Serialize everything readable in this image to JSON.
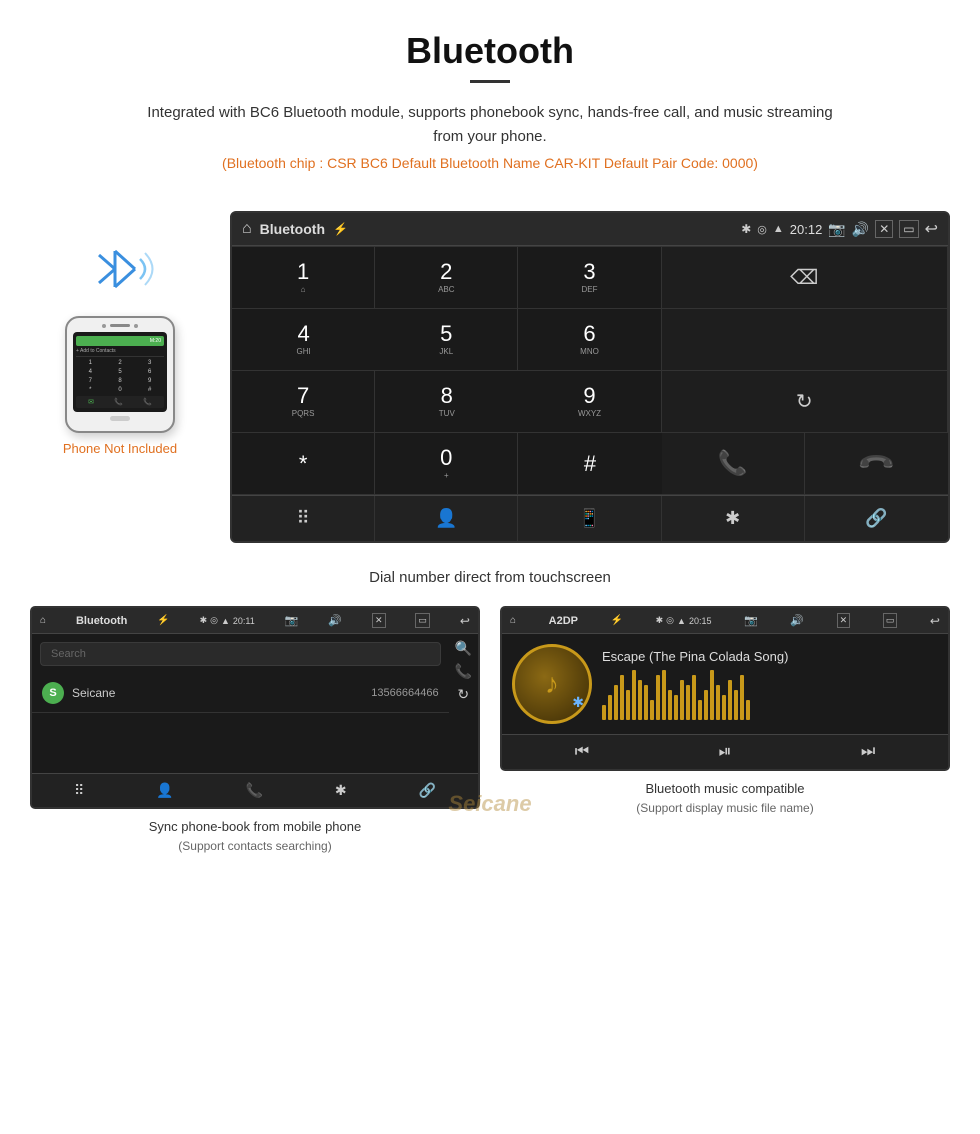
{
  "header": {
    "title": "Bluetooth",
    "underline": true,
    "description": "Integrated with BC6 Bluetooth module, supports phonebook sync, hands-free call, and music streaming from your phone.",
    "specs": "(Bluetooth chip : CSR BC6   Default Bluetooth Name CAR-KIT    Default Pair Code: 0000)"
  },
  "phone_label": "Phone Not Included",
  "main_screen": {
    "topbar": {
      "title": "Bluetooth",
      "time": "20:12"
    },
    "dialpad": [
      {
        "num": "1",
        "alpha": "⌂",
        "row": 1
      },
      {
        "num": "2",
        "alpha": "ABC",
        "row": 1
      },
      {
        "num": "3",
        "alpha": "DEF",
        "row": 1
      },
      {
        "num": "4",
        "alpha": "GHI",
        "row": 2
      },
      {
        "num": "5",
        "alpha": "JKL",
        "row": 2
      },
      {
        "num": "6",
        "alpha": "MNO",
        "row": 2
      },
      {
        "num": "7",
        "alpha": "PQRS",
        "row": 3
      },
      {
        "num": "8",
        "alpha": "TUV",
        "row": 3
      },
      {
        "num": "9",
        "alpha": "WXYZ",
        "row": 3
      },
      {
        "num": "*",
        "alpha": "",
        "row": 4
      },
      {
        "num": "0",
        "alpha": "+",
        "row": 4
      },
      {
        "num": "#",
        "alpha": "",
        "row": 4
      }
    ]
  },
  "main_caption": "Dial number direct from touchscreen",
  "bottom_left": {
    "topbar_title": "Bluetooth",
    "topbar_time": "20:11",
    "search_placeholder": "Search",
    "contact": {
      "initial": "S",
      "name": "Seicane",
      "number": "13566664466"
    },
    "caption": "Sync phone-book from mobile phone",
    "caption_sub": "(Support contacts searching)"
  },
  "bottom_right": {
    "topbar_title": "A2DP",
    "topbar_time": "20:15",
    "song_title": "Escape (The Pina Colada Song)",
    "caption": "Bluetooth music compatible",
    "caption_sub": "(Support display music file name)"
  },
  "watermark": "Seicane",
  "vis_bars": [
    15,
    25,
    35,
    45,
    30,
    50,
    40,
    35,
    20,
    45,
    50,
    30,
    25,
    40,
    35,
    45,
    20,
    30,
    50,
    35,
    25,
    40,
    30,
    45,
    20
  ]
}
